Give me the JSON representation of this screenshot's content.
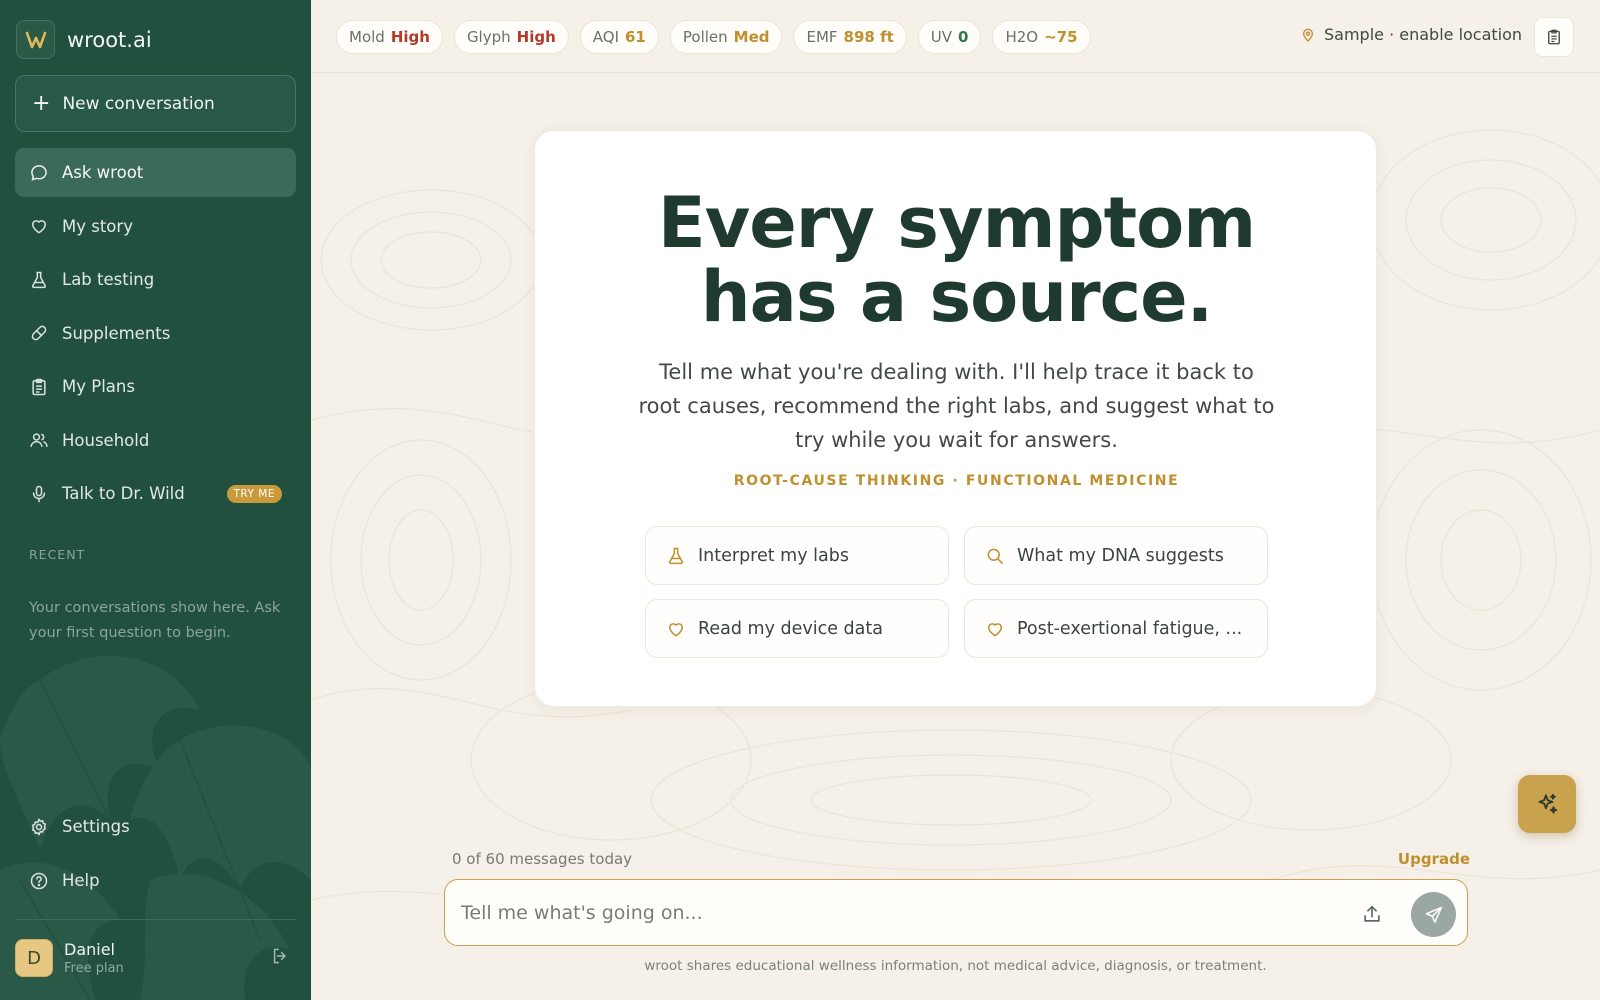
{
  "brand": {
    "name": "wroot.ai",
    "logo_letter": "W"
  },
  "sidebar": {
    "new_conversation": "New conversation",
    "items": [
      {
        "label": "Ask wroot",
        "icon": "chat-bubble-icon",
        "active": true
      },
      {
        "label": "My story",
        "icon": "heart-icon"
      },
      {
        "label": "Lab testing",
        "icon": "flask-icon"
      },
      {
        "label": "Supplements",
        "icon": "pill-icon"
      },
      {
        "label": "My Plans",
        "icon": "clipboard-icon"
      },
      {
        "label": "Household",
        "icon": "people-icon"
      },
      {
        "label": "Talk to Dr. Wild",
        "icon": "microphone-icon",
        "badge": "TRY ME"
      }
    ],
    "recent_label": "RECENT",
    "recent_empty": "Your conversations show here. Ask your first question to begin.",
    "bottom_items": [
      {
        "label": "Settings",
        "icon": "gear-icon"
      },
      {
        "label": "Help",
        "icon": "help-circle-icon"
      }
    ],
    "user": {
      "initial": "D",
      "name": "Daniel",
      "plan": "Free plan"
    }
  },
  "topbar": {
    "chips": [
      {
        "label": "Mold",
        "value": "High",
        "color": "#b23a2a"
      },
      {
        "label": "Glyph",
        "value": "High",
        "color": "#b23a2a"
      },
      {
        "label": "AQI",
        "value": "61",
        "color": "#c08f2e"
      },
      {
        "label": "Pollen",
        "value": "Med",
        "color": "#c08f2e"
      },
      {
        "label": "EMF",
        "value": "898 ft",
        "color": "#c08f2e"
      },
      {
        "label": "UV",
        "value": "0",
        "color": "#2f7a4e"
      },
      {
        "label": "H2O",
        "value": "~75",
        "color": "#c08f2e"
      }
    ],
    "location": "Sample · enable location"
  },
  "hero": {
    "headline_line1": "Every symptom",
    "headline_line2": "has a source.",
    "subtext": "Tell me what you're dealing with. I'll help trace it back to root causes, recommend the right labs, and suggest what to try while you wait for answers.",
    "tagline": "ROOT-CAUSE THINKING · FUNCTIONAL MEDICINE",
    "suggestions": [
      {
        "label": "Interpret my labs",
        "icon": "flask-icon"
      },
      {
        "label": "What my DNA suggests",
        "icon": "search-icon"
      },
      {
        "label": "Read my device data",
        "icon": "heart-icon"
      },
      {
        "label": "Post-exertional fatigue, ...",
        "icon": "heart-icon"
      }
    ]
  },
  "composer": {
    "message_count": "0 of 60 messages today",
    "upgrade": "Upgrade",
    "placeholder": "Tell me what's going on...",
    "disclaimer": "wroot shares educational wellness information, not medical advice, diagnosis, or treatment."
  },
  "colors": {
    "sidebar": "#22503e",
    "accent": "#c08f2e",
    "background": "#f5f0e8"
  }
}
